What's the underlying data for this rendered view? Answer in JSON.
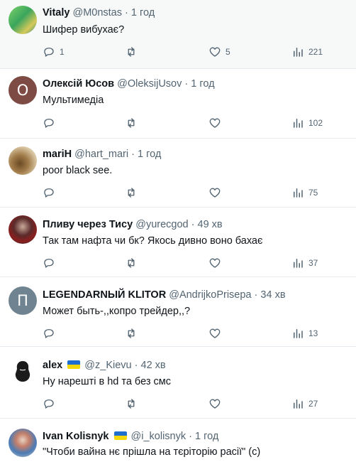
{
  "colors": {
    "accent": "#1d9bf0",
    "muted": "#536471"
  },
  "tweets": [
    {
      "name": "Vitaly",
      "handle": "@M0nstas",
      "time": "1 год",
      "text": "Шифер вибухає?",
      "reply": "1",
      "retweet": "",
      "like": "5",
      "views": "221",
      "avatar_letter": "",
      "flag": false
    },
    {
      "name": "Олексій Юсов",
      "handle": "@OleksijUsov",
      "time": "1 год",
      "text": "Мультимедіа",
      "reply": "",
      "retweet": "",
      "like": "",
      "views": "102",
      "avatar_letter": "О",
      "flag": false
    },
    {
      "name": "mariH",
      "handle": "@hart_mari",
      "time": "1 год",
      "text": "poor black see.",
      "reply": "",
      "retweet": "",
      "like": "",
      "views": "75",
      "avatar_letter": "",
      "flag": false
    },
    {
      "name": "Пливу через Тису",
      "handle": "@yurecgod",
      "time": "49 хв",
      "text": "Так там нафта чи бк? Якось дивно воно бахає",
      "reply": "",
      "retweet": "",
      "like": "",
      "views": "37",
      "avatar_letter": "",
      "flag": false
    },
    {
      "name": "LEGENDARNЫЙ KLITOR",
      "handle": "@AndrijkoPrisepa",
      "time": "34 хв",
      "text": "Может быть-,,копро трейдер,,?",
      "reply": "",
      "retweet": "",
      "like": "",
      "views": "13",
      "avatar_letter": "П",
      "flag": false
    },
    {
      "name": "alex",
      "handle": "@z_Kievu",
      "time": "42 хв",
      "text": "Ну нарешті в hd та без смс",
      "reply": "",
      "retweet": "",
      "like": "",
      "views": "27",
      "avatar_letter": "",
      "flag": true
    },
    {
      "name": "Ivan Kolisnyk",
      "handle": "@i_kolisnyk",
      "time": "1 год",
      "text": "\"Чтоби вайна нє прішла на тєріторію расії\" (с)",
      "reply": "",
      "retweet": "",
      "like": "",
      "views": "",
      "avatar_letter": "",
      "flag": true
    }
  ]
}
